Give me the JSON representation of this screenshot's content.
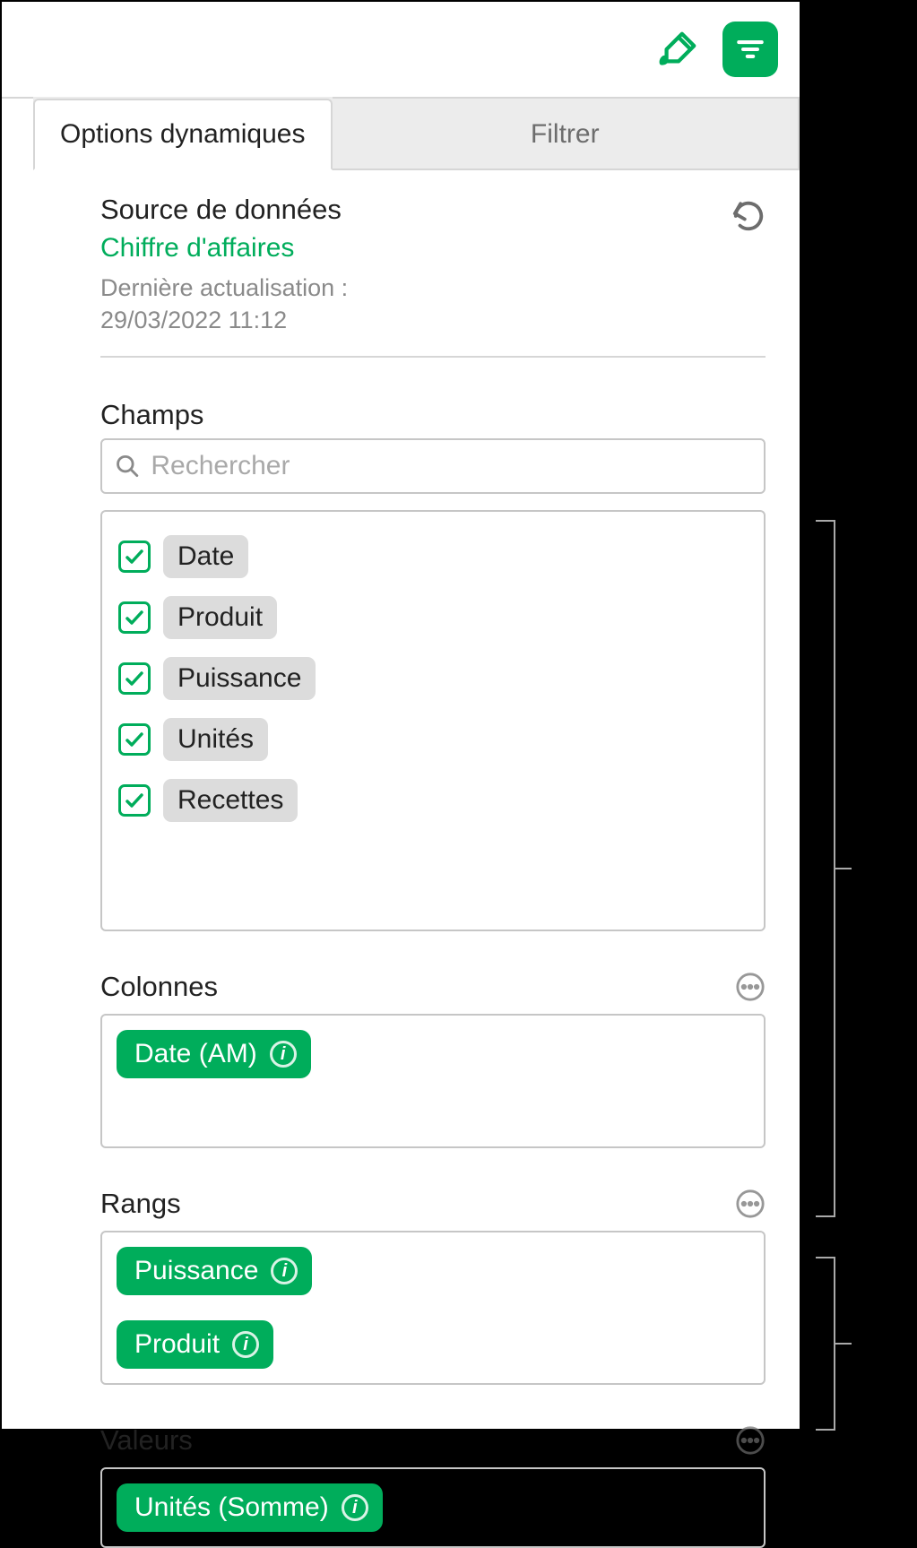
{
  "toolbar": {
    "format_icon": "format-brush-icon",
    "organize_icon": "organize-icon"
  },
  "tabs": {
    "dynamic": "Options dynamiques",
    "filter": "Filtrer"
  },
  "source": {
    "title": "Source de données",
    "name": "Chiffre d'affaires",
    "updated_label": "Dernière actualisation :",
    "updated_value": "29/03/2022 11:12"
  },
  "fields": {
    "title": "Champs",
    "search_placeholder": "Rechercher",
    "items": [
      {
        "label": "Date",
        "checked": true
      },
      {
        "label": "Produit",
        "checked": true
      },
      {
        "label": "Puissance",
        "checked": true
      },
      {
        "label": "Unités",
        "checked": true
      },
      {
        "label": "Recettes",
        "checked": true
      }
    ]
  },
  "columns": {
    "title": "Colonnes",
    "items": [
      {
        "label": "Date (AM)"
      }
    ]
  },
  "rows": {
    "title": "Rangs",
    "items": [
      {
        "label": "Puissance"
      },
      {
        "label": "Produit"
      }
    ]
  },
  "values": {
    "title": "Valeurs",
    "items": [
      {
        "label": "Unités (Somme)"
      }
    ]
  }
}
